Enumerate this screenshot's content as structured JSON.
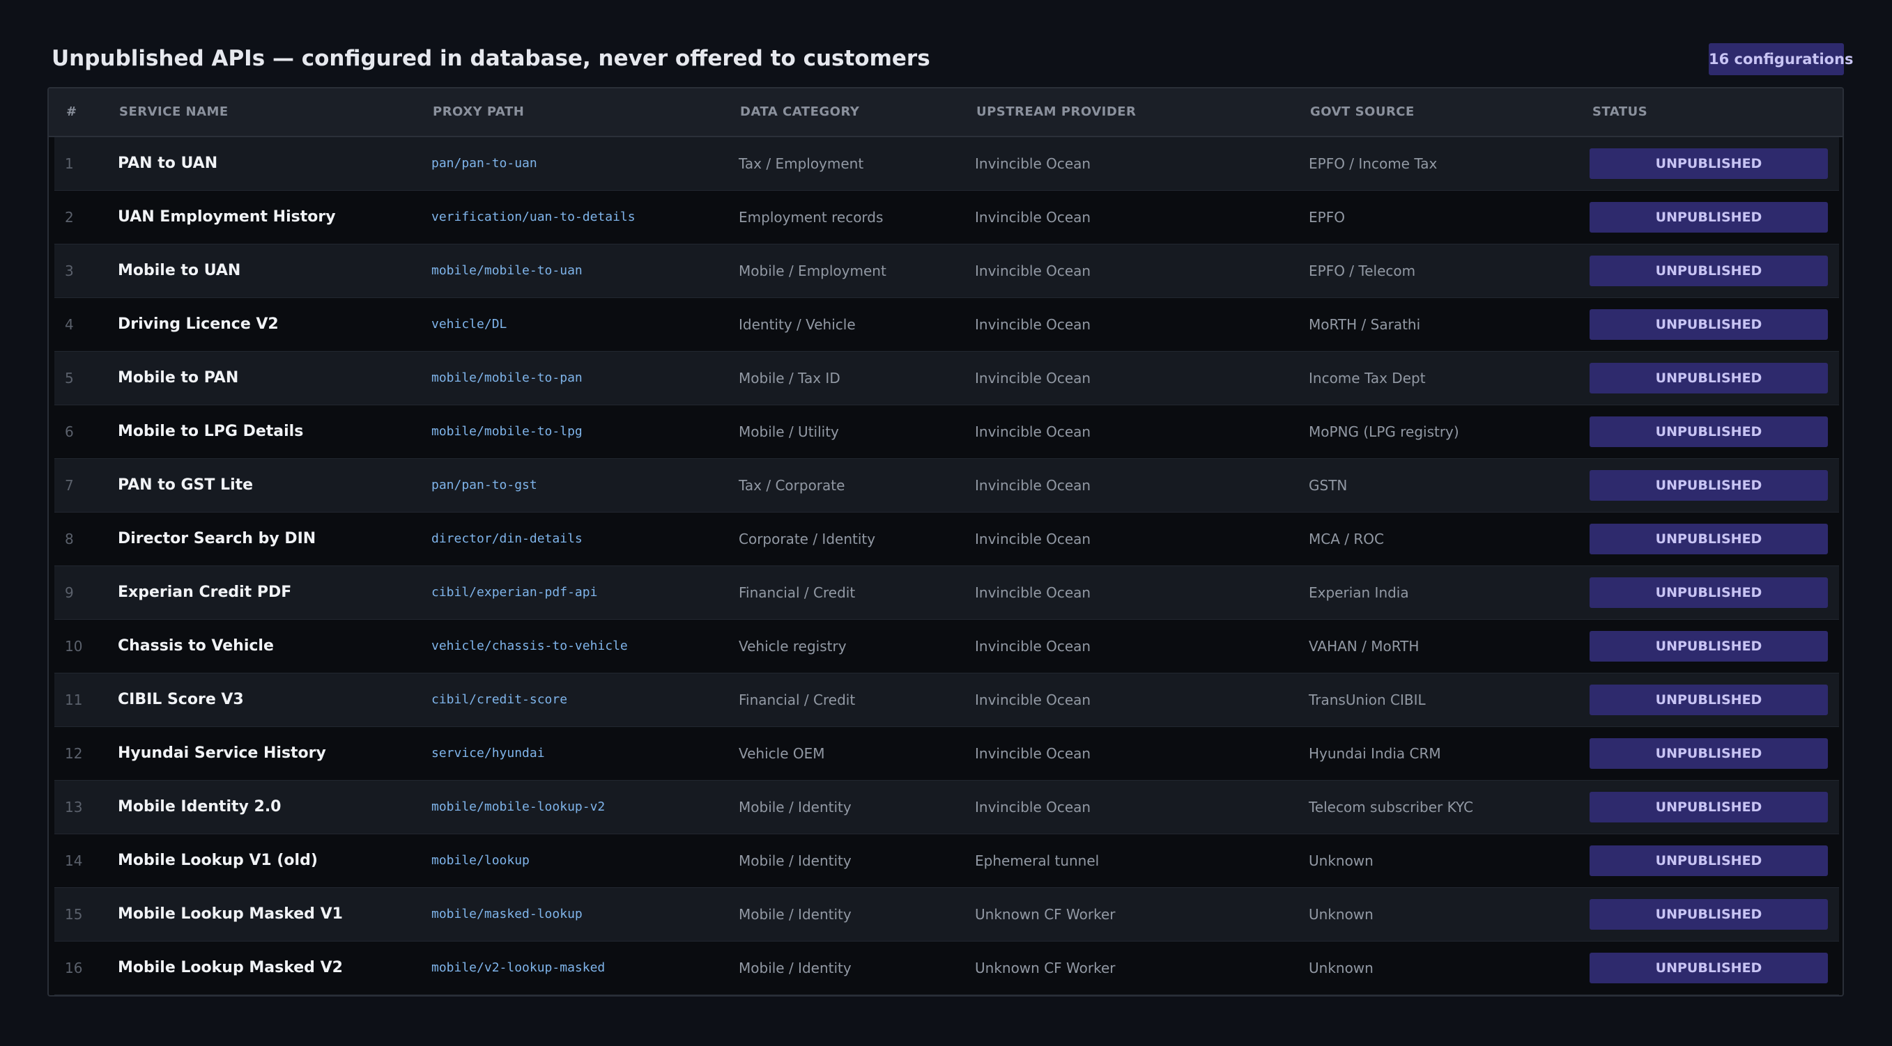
{
  "page": {
    "title": "Unpublished APIs — configured in database, never offered to customers",
    "count_badge": "16 configurations"
  },
  "table": {
    "headers": [
      "#",
      "SERVICE NAME",
      "PROXY PATH",
      "DATA CATEGORY",
      "UPSTREAM PROVIDER",
      "GOVT SOURCE",
      "STATUS"
    ],
    "rows": [
      {
        "num": "1",
        "name": "PAN to UAN",
        "path": "pan/pan-to-uan",
        "category": "Tax / Employment",
        "provider": "Invincible Ocean",
        "source": "EPFO / Income Tax",
        "status": "UNPUBLISHED"
      },
      {
        "num": "2",
        "name": "UAN Employment History",
        "path": "verification/uan-to-details",
        "category": "Employment records",
        "provider": "Invincible Ocean",
        "source": "EPFO",
        "status": "UNPUBLISHED"
      },
      {
        "num": "3",
        "name": "Mobile to UAN",
        "path": "mobile/mobile-to-uan",
        "category": "Mobile / Employment",
        "provider": "Invincible Ocean",
        "source": "EPFO / Telecom",
        "status": "UNPUBLISHED"
      },
      {
        "num": "4",
        "name": "Driving Licence V2",
        "path": "vehicle/DL",
        "category": "Identity / Vehicle",
        "provider": "Invincible Ocean",
        "source": "MoRTH / Sarathi",
        "status": "UNPUBLISHED"
      },
      {
        "num": "5",
        "name": "Mobile to PAN",
        "path": "mobile/mobile-to-pan",
        "category": "Mobile / Tax ID",
        "provider": "Invincible Ocean",
        "source": "Income Tax Dept",
        "status": "UNPUBLISHED"
      },
      {
        "num": "6",
        "name": "Mobile to LPG Details",
        "path": "mobile/mobile-to-lpg",
        "category": "Mobile / Utility",
        "provider": "Invincible Ocean",
        "source": "MoPNG (LPG registry)",
        "status": "UNPUBLISHED"
      },
      {
        "num": "7",
        "name": "PAN to GST Lite",
        "path": "pan/pan-to-gst",
        "category": "Tax / Corporate",
        "provider": "Invincible Ocean",
        "source": "GSTN",
        "status": "UNPUBLISHED"
      },
      {
        "num": "8",
        "name": "Director Search by DIN",
        "path": "director/din-details",
        "category": "Corporate / Identity",
        "provider": "Invincible Ocean",
        "source": "MCA / ROC",
        "status": "UNPUBLISHED"
      },
      {
        "num": "9",
        "name": "Experian Credit PDF",
        "path": "cibil/experian-pdf-api",
        "category": "Financial / Credit",
        "provider": "Invincible Ocean",
        "source": "Experian India",
        "status": "UNPUBLISHED"
      },
      {
        "num": "10",
        "name": "Chassis to Vehicle",
        "path": "vehicle/chassis-to-vehicle",
        "category": "Vehicle registry",
        "provider": "Invincible Ocean",
        "source": "VAHAN / MoRTH",
        "status": "UNPUBLISHED"
      },
      {
        "num": "11",
        "name": "CIBIL Score V3",
        "path": "cibil/credit-score",
        "category": "Financial / Credit",
        "provider": "Invincible Ocean",
        "source": "TransUnion CIBIL",
        "status": "UNPUBLISHED"
      },
      {
        "num": "12",
        "name": "Hyundai Service History",
        "path": "service/hyundai",
        "category": "Vehicle OEM",
        "provider": "Invincible Ocean",
        "source": "Hyundai India CRM",
        "status": "UNPUBLISHED"
      },
      {
        "num": "13",
        "name": "Mobile Identity 2.0",
        "path": "mobile/mobile-lookup-v2",
        "category": "Mobile / Identity",
        "provider": "Invincible Ocean",
        "source": "Telecom subscriber KYC",
        "status": "UNPUBLISHED"
      },
      {
        "num": "14",
        "name": "Mobile Lookup V1 (old)",
        "path": "mobile/lookup",
        "category": "Mobile / Identity",
        "provider": "Ephemeral tunnel",
        "source": "Unknown",
        "status": "UNPUBLISHED"
      },
      {
        "num": "15",
        "name": "Mobile Lookup Masked V1",
        "path": "mobile/masked-lookup",
        "category": "Mobile / Identity",
        "provider": "Unknown CF Worker",
        "source": "Unknown",
        "status": "UNPUBLISHED"
      },
      {
        "num": "16",
        "name": "Mobile Lookup Masked V2",
        "path": "mobile/v2-lookup-masked",
        "category": "Mobile / Identity",
        "provider": "Unknown CF Worker",
        "source": "Unknown",
        "status": "UNPUBLISHED"
      }
    ]
  },
  "colors": {
    "background": "#0d1017",
    "header_row": "#1b1f27",
    "row_odd": "#161a21",
    "row_even": "#0a0c10",
    "status_badge": "#2e2a6d",
    "status_text": "#c8c4f4",
    "proxy_path": "#7fb4ea"
  }
}
